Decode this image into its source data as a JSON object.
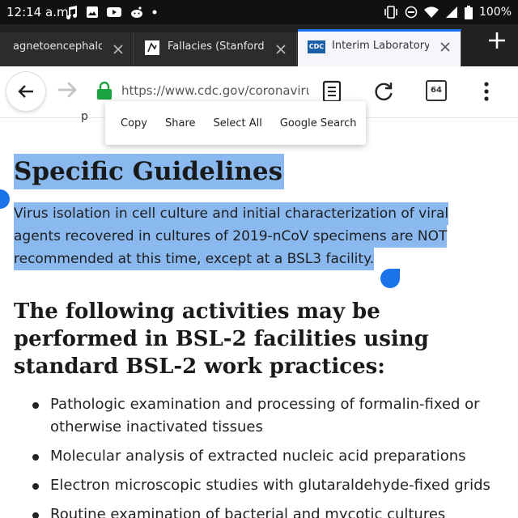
{
  "status_bar": {
    "time": "12:14 a.m.",
    "battery": "100%",
    "notif_icons": [
      "music-note-icon",
      "image-icon",
      "youtube-icon",
      "reddit-icon",
      "dot-icon"
    ],
    "system_icons": [
      "vibrate-icon",
      "do-not-disturb-icon",
      "wifi-icon",
      "cell-signal-icon",
      "battery-icon"
    ]
  },
  "tabs": [
    {
      "title": "agnetoencephalog",
      "active": false
    },
    {
      "title": "Fallacies (Stanford E",
      "active": false
    },
    {
      "title": "Interim Laboratory B",
      "active": true,
      "favicon": "CDC"
    }
  ],
  "toolbar": {
    "url": "https://www.cdc.gov/coronaviru",
    "tab_count": "64"
  },
  "context_menu": {
    "items": [
      "Copy",
      "Share",
      "Select All",
      "Google Search"
    ]
  },
  "article": {
    "partial_text": "p",
    "heading": "Specific Guidelines",
    "selected_paragraph": [
      "Virus isolation in cell culture and initial characterization of viral",
      "agents recovered in cultures of 2019-nCoV specimens are NOT",
      "recommended at this time, except at a BSL3 facility."
    ],
    "subheading": "The following activities may be performed in BSL-2 facilities using standard BSL-2 work practices:",
    "list_items": [
      "Pathologic examination and processing of formalin-fixed or otherwise inactivated tissues",
      "Molecular analysis of extracted nucleic acid preparations",
      "Electron microscopic studies with glutaraldehyde-fixed grids",
      "Routine examination of bacterial and mycotic cultures"
    ]
  },
  "colors": {
    "selection": "#8ab9ef",
    "accent": "#1a73e8",
    "lock": "#1aa340",
    "status_bar": "#111111",
    "tab_strip": "#222222"
  }
}
